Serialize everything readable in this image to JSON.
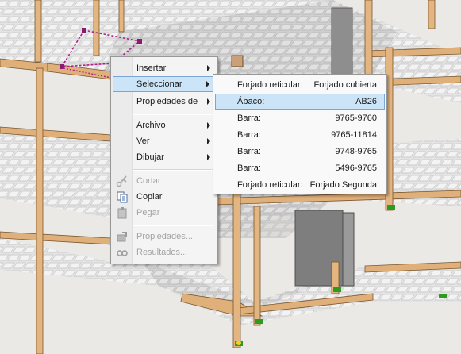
{
  "context_menu": {
    "items": [
      {
        "label": "Insertar",
        "submenu": true,
        "enabled": true
      },
      {
        "label": "Seleccionar",
        "submenu": true,
        "enabled": true,
        "highlighted": true
      },
      {
        "label": "Propiedades de",
        "submenu": true,
        "enabled": true
      },
      {
        "label": "Archivo",
        "submenu": true,
        "enabled": true
      },
      {
        "label": "Ver",
        "submenu": true,
        "enabled": true
      },
      {
        "label": "Dibujar",
        "submenu": true,
        "enabled": true
      },
      {
        "label": "Cortar",
        "icon": "scissors-icon",
        "enabled": false
      },
      {
        "label": "Copiar",
        "icon": "copy-icon",
        "enabled": true
      },
      {
        "label": "Pegar",
        "icon": "paste-icon",
        "enabled": false
      },
      {
        "label": "Propiedades...",
        "icon": "properties-icon",
        "enabled": false
      },
      {
        "label": "Resultados...",
        "icon": "results-icon",
        "enabled": false
      }
    ]
  },
  "select_submenu": {
    "items": [
      {
        "type": "Forjado reticular:",
        "value": "Forjado cubierta"
      },
      {
        "type": "Ábaco:",
        "value": "AB26",
        "highlighted": true
      },
      {
        "type": "Barra:",
        "value": "9765-9760"
      },
      {
        "type": "Barra:",
        "value": "9765-11814"
      },
      {
        "type": "Barra:",
        "value": "9748-9765"
      },
      {
        "type": "Barra:",
        "value": "5496-9765"
      },
      {
        "type": "Forjado reticular:",
        "value": "Forjado Segunda"
      }
    ]
  },
  "colors": {
    "menu_highlight": "#cce4f7",
    "menu_highlight_border": "#7aa6d6",
    "selection_outline": "#b0208a",
    "wood_beam": "#e0b07a",
    "support_marker": "#2e9a1f"
  }
}
